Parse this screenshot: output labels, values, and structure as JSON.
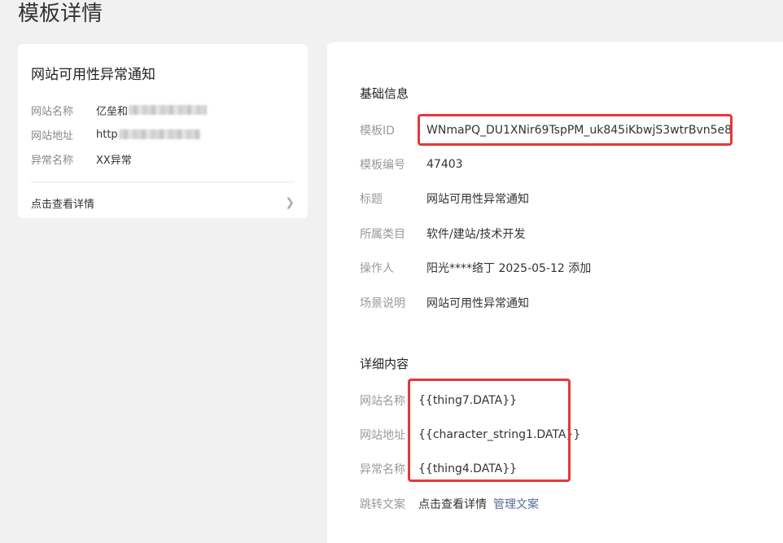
{
  "page": {
    "title": "模板详情"
  },
  "preview": {
    "title": "网站可用性异常通知",
    "fields": [
      {
        "label": "网站名称",
        "value": "亿垒和"
      },
      {
        "label": "网站地址",
        "value": "http"
      },
      {
        "label": "异常名称",
        "value": "XX异常"
      }
    ],
    "link_label": "点击查看详情"
  },
  "basic": {
    "section_title": "基础信息",
    "rows": [
      {
        "label": "模板ID",
        "value": "WNmaPQ_DU1XNir69TspPM_uk845iKbwjS3wtrBvn5e8"
      },
      {
        "label": "模板编号",
        "value": "47403"
      },
      {
        "label": "标题",
        "value": "网站可用性异常通知"
      },
      {
        "label": "所属类目",
        "value": "软件/建站/技术开发"
      },
      {
        "label": "操作人",
        "value": "阳光****络丁 2025-05-12 添加"
      },
      {
        "label": "场景说明",
        "value": "网站可用性异常通知"
      }
    ]
  },
  "detail": {
    "section_title": "详细内容",
    "rows": [
      {
        "label": "网站名称",
        "value": "{{thing7.DATA}}"
      },
      {
        "label": "网站地址",
        "value": "{{character_string1.DATA}}"
      },
      {
        "label": "异常名称",
        "value": "{{thing4.DATA}}"
      }
    ],
    "jump": {
      "label": "跳转文案",
      "value": "点击查看详情",
      "manage_link": "管理文案"
    }
  },
  "colors": {
    "highlight": "#e5383b",
    "link": "#576b95"
  }
}
